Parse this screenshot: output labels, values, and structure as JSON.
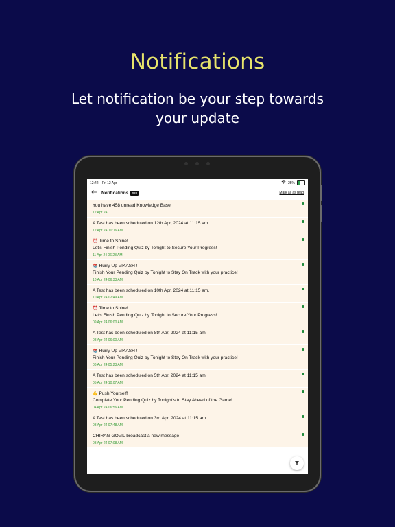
{
  "hero": {
    "title": "Notifications",
    "subtitle": "Let notification be your step towards your update"
  },
  "status_bar": {
    "time": "12:42",
    "date": "Fri 12 Apr",
    "battery": "25%",
    "battery_level": 0.25
  },
  "header": {
    "title": "Notifications",
    "badge": "318",
    "mark_all_label": "Mark all as read"
  },
  "colors": {
    "background": "#0b0b4a",
    "title": "#e6e36b",
    "card": "#fdf4e8",
    "date": "#3b9e3b",
    "unread_dot": "#1f8a3a"
  },
  "notifications": [
    {
      "emoji": "",
      "title": "You have 458 unread Knowledge Base.",
      "body": "",
      "date": "12 Apr 24"
    },
    {
      "emoji": "",
      "title": "A Test has been scheduled on 12th Apr, 2024 at 11:15 am.",
      "body": "",
      "date": "12 Apr 24 10:16 AM"
    },
    {
      "emoji": "⏰",
      "title": "Time to Shine!",
      "body": "Let's Finish Pending Quiz by Tonight to Secure Your Progress!",
      "date": "11 Apr 24 06:28 AM"
    },
    {
      "emoji": "📚",
      "title": "Hurry Up VIKASH !",
      "body": "Finish Your Pending Quiz by Tonight to Stay On Track with your practice!",
      "date": "10 Apr 24 06:33 AM"
    },
    {
      "emoji": "",
      "title": "A Test has been scheduled on 10th Apr, 2024 at 11:15 am.",
      "body": "",
      "date": "10 Apr 24 02:49 AM"
    },
    {
      "emoji": "⏰",
      "title": "Time to Shine!",
      "body": "Let's Finish Pending Quiz by Tonight to Secure Your Progress!",
      "date": "09 Apr 24 06:00 AM"
    },
    {
      "emoji": "",
      "title": "A Test has been scheduled on 8th Apr, 2024 at 11:15 am.",
      "body": "",
      "date": "08 Apr 24 06:00 AM"
    },
    {
      "emoji": "📚",
      "title": "Hurry Up VIKASH !",
      "body": "Finish Your Pending Quiz by Tonight to Stay On Track with your practice!",
      "date": "06 Apr 24 05:23 AM"
    },
    {
      "emoji": "",
      "title": "A Test has been scheduled on 5th Apr, 2024 at 11:15 am.",
      "body": "",
      "date": "05 Apr 24 10:07 AM"
    },
    {
      "emoji": "💪",
      "title": "Push Yourself!",
      "body": "Complete Your Pending Quiz by Tonight's to Stay Ahead of the Game!",
      "date": "04 Apr 24 06:56 AM"
    },
    {
      "emoji": "",
      "title": "A Test has been scheduled on 3rd Apr, 2024 at 11:15 am.",
      "body": "",
      "date": "03 Apr 24 07:48 AM"
    },
    {
      "emoji": "",
      "title": "CHIRAG GOVIL broadcast a new message",
      "body": "",
      "date": "03 Apr 24 07:08 AM"
    }
  ],
  "icons": {
    "back": "arrow-left-icon",
    "filter": "filter-icon",
    "wifi": "wifi-icon",
    "battery": "battery-icon"
  }
}
